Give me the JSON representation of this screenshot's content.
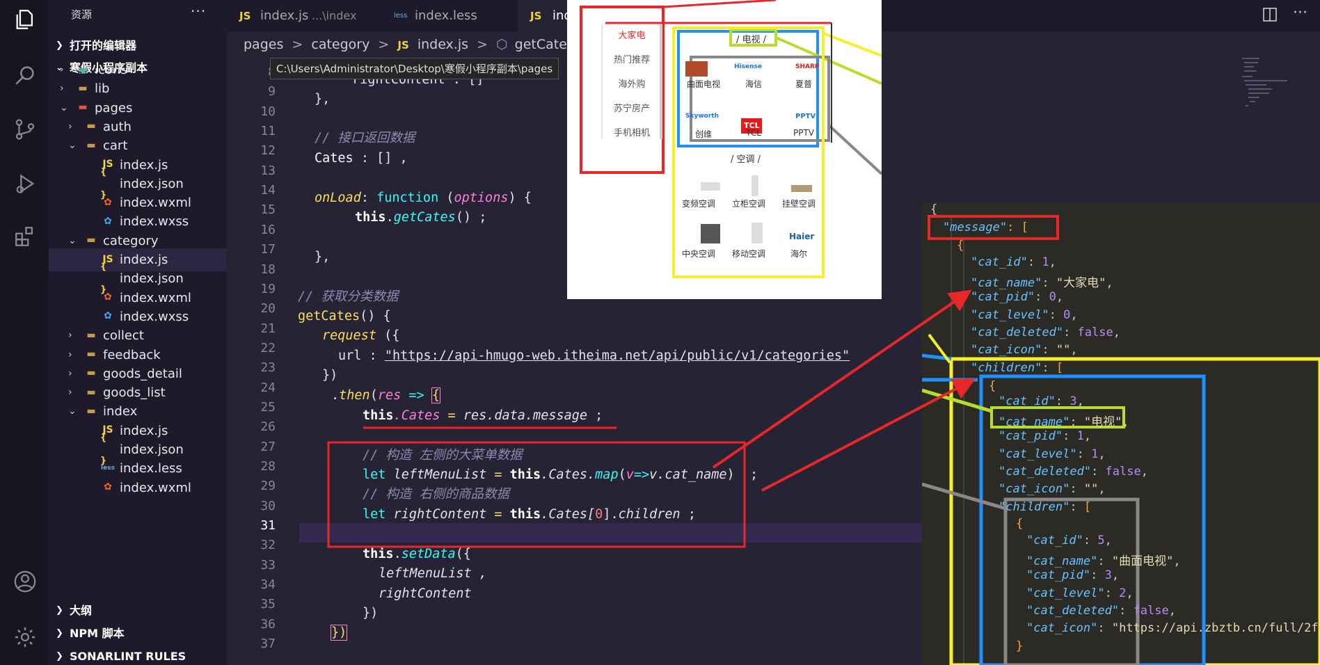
{
  "activity_bar": {
    "icons": [
      "files-icon",
      "search-icon",
      "source-control-icon",
      "run-debug-icon",
      "extensions-icon",
      "account-icon",
      "settings-gear-icon"
    ]
  },
  "sidebar": {
    "title": "资源",
    "more": "···",
    "sections": {
      "open_editors": "打开的编辑器",
      "project": "寒假小程序副本",
      "outline": "大纲",
      "npm": "NPM 脚本",
      "sonarlint": "SONARLINT RULES"
    },
    "tree": [
      {
        "label": "icons"
      },
      {
        "label": "lib"
      },
      {
        "label": "pages"
      },
      {
        "label": "auth"
      },
      {
        "label": "cart"
      },
      {
        "label": "index.js"
      },
      {
        "label": "index.json"
      },
      {
        "label": "index.wxml"
      },
      {
        "label": "index.wxss"
      },
      {
        "label": "category"
      },
      {
        "label": "index.js"
      },
      {
        "label": "index.json"
      },
      {
        "label": "index.wxml"
      },
      {
        "label": "index.wxss"
      },
      {
        "label": "collect"
      },
      {
        "label": "feedback"
      },
      {
        "label": "goods_detail"
      },
      {
        "label": "goods_list"
      },
      {
        "label": "index"
      },
      {
        "label": "index.js"
      },
      {
        "label": "index.json"
      },
      {
        "label": "index.less"
      },
      {
        "label": "index.wxml"
      }
    ]
  },
  "tabs": [
    {
      "icon": "JS",
      "label": "index.js",
      "hint": "...\\index"
    },
    {
      "icon": "less",
      "label": "index.less"
    },
    {
      "icon": "JS",
      "label": "inde"
    }
  ],
  "breadcrumb": {
    "parts": [
      "pages",
      "category",
      "index.js",
      "getCates"
    ],
    "js_icon": "JS",
    "sep": ">"
  },
  "tooltip": "C:\\Users\\Administrator\\Desktop\\寒假小程序副本\\pages",
  "editor": {
    "line_numbers": [
      "8",
      "9",
      "10",
      "11",
      "12",
      "13",
      "14",
      "15",
      "16",
      "17",
      "18",
      "19",
      "20",
      "21",
      "22",
      "23",
      "24",
      "25",
      "26",
      "27",
      "28",
      "29",
      "30",
      "31",
      "32",
      "33",
      "34",
      "35",
      "36",
      "37"
    ],
    "current_line": "31",
    "tokens": {
      "l8": "rightContent : []",
      "l9": "},",
      "l11": "// 接口返回数据",
      "l12a": "Cates",
      "l12b": " : [] ,",
      "l14a": "onLoad",
      "l14b": ": ",
      "l14c": "function",
      "l14d": " (",
      "l14e": "options",
      "l14f": ") {",
      "l15a": "this",
      "l15b": ".",
      "l15c": "getCates",
      "l15d": "() ;",
      "l17": "},",
      "l19": "// 获取分类数据",
      "l20a": "getCates",
      "l20b": "() {",
      "l21a": "request",
      "l21b": " ({",
      "l22a": "url : ",
      "l22b": "\"https://api-hmugo-web.itheima.net/api/public/v1/categories\"",
      "l23": "})",
      "l24a": ".",
      "l24b": "then",
      "l24c": "(",
      "l24d": "res",
      "l24e": " => ",
      "l24f": "{",
      "l25a": "this",
      "l25b": ".Cates",
      "l25c": " = ",
      "l25d": "res.data.message",
      "l25e": " ;",
      "l27": "// 构造 左侧的大菜单数据",
      "l28a": "let",
      "l28b": " leftMenuList",
      "l28c": " = ",
      "l28d": "this",
      "l28e": ".Cates.",
      "l28f": "map",
      "l28g": "(",
      "l28h": "v",
      "l28i": "=>",
      "l28j": "v.cat_name",
      "l28k": ")  ;",
      "l29": "// 构造 右侧的商品数据",
      "l30a": "let",
      "l30b": " rightContent",
      "l30c": " = ",
      "l30d": "this",
      "l30e": ".Cates[",
      "l30f": "0",
      "l30g": "].",
      "l30h": "children",
      "l30i": " ;",
      "l32a": "this",
      "l32b": ".",
      "l32c": "setData",
      "l32d": "({",
      "l33": "leftMenuList ,",
      "l34": "rightContent",
      "l35": "})",
      "l36": "})"
    }
  },
  "app_preview": {
    "left_menu": [
      "大家电",
      "热门推荐",
      "海外购",
      "苏宁房产",
      "手机相机"
    ],
    "tv_title": "/ 电视 /",
    "tv_items": [
      "曲面电视",
      "海信",
      "夏普",
      "创维",
      "TCL",
      "PPTV"
    ],
    "ac_title": "/ 空调 /",
    "ac_items": [
      "变频空调",
      "立柜空调",
      "挂壁空调",
      "中央空调",
      "移动空调",
      "海尔"
    ],
    "brand_labels": {
      "hisense": "Hisense",
      "sharp": "SHARP",
      "skyworth": "Skyworth",
      "tcl": "TCL",
      "pptv": "PPTV",
      "haier": "Haier"
    }
  },
  "json_preview": {
    "open": "{",
    "message_key": "\"message\"",
    "message_open": ": [",
    "obj_open": "{",
    "l1": {
      "k": "\"cat_id\"",
      "v": "1"
    },
    "l2": {
      "k": "\"cat_name\"",
      "v": "\"大家电\""
    },
    "l3": {
      "k": "\"cat_pid\"",
      "v": "0"
    },
    "l4": {
      "k": "\"cat_level\"",
      "v": "0"
    },
    "l5": {
      "k": "\"cat_deleted\"",
      "v": "false"
    },
    "l6": {
      "k": "\"cat_icon\"",
      "v": "\"\""
    },
    "children1": "\"children\"",
    "c1": {
      "k": "\"cat_id\"",
      "v": "3"
    },
    "c2": {
      "k": "\"cat_name\"",
      "v": "\"电视\""
    },
    "c3": {
      "k": "\"cat_pid\"",
      "v": "1"
    },
    "c4": {
      "k": "\"cat_level\"",
      "v": "1"
    },
    "c5": {
      "k": "\"cat_deleted\"",
      "v": "false"
    },
    "c6": {
      "k": "\"cat_icon\"",
      "v": "\"\""
    },
    "children2": "\"children\"",
    "g1": {
      "k": "\"cat_id\"",
      "v": "5"
    },
    "g2": {
      "k": "\"cat_name\"",
      "v": "\"曲面电视\""
    },
    "g3": {
      "k": "\"cat_pid\"",
      "v": "3"
    },
    "g4": {
      "k": "\"cat_level\"",
      "v": "2"
    },
    "g5": {
      "k": "\"cat_deleted\"",
      "v": "false"
    },
    "g6": {
      "k": "\"cat_icon\"",
      "v": "\"https://api.zbztb.cn/full/2f"
    },
    "close": "}"
  },
  "colors": {
    "accent_red": "#e8272a",
    "accent_yellow": "#f5ef2c",
    "accent_blue": "#1e90ff",
    "accent_gray": "#888888",
    "accent_lime": "#b6de2a"
  }
}
